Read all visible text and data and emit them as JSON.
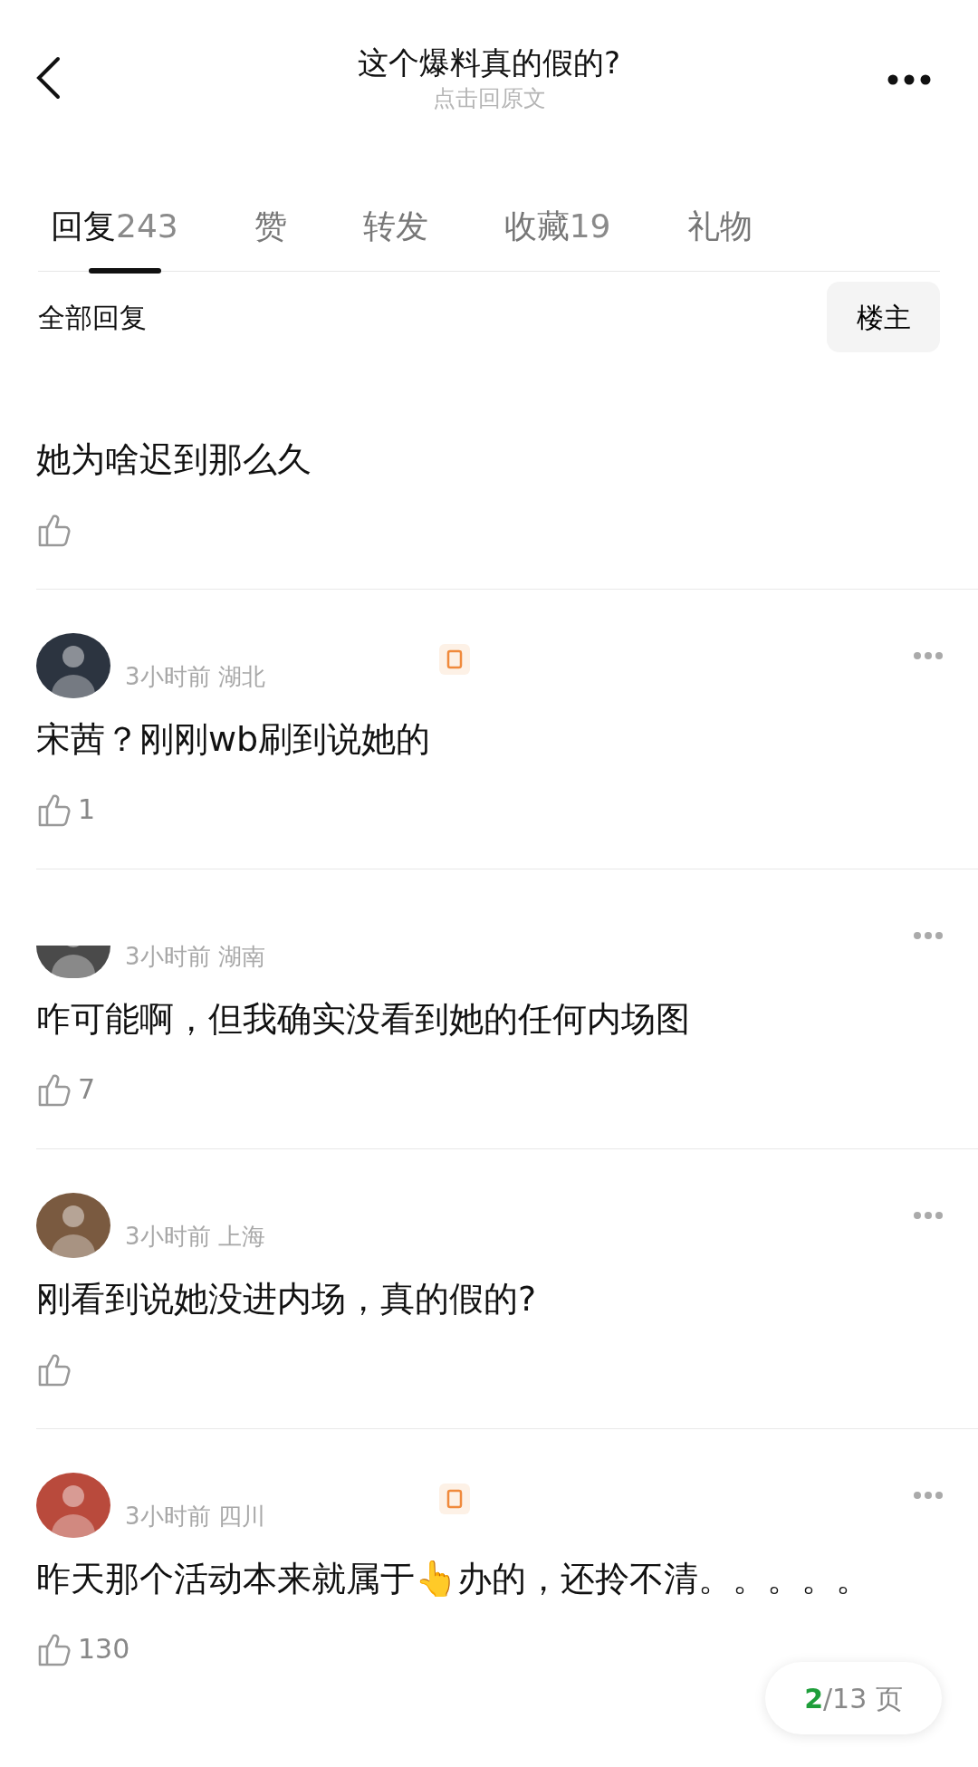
{
  "header": {
    "title": "这个爆料真的假的?",
    "subtitle": "点击回原文"
  },
  "tabs": [
    {
      "label": "回复",
      "count": "243",
      "selected": true
    },
    {
      "label": "赞",
      "selected": false
    },
    {
      "label": "转发",
      "selected": false
    },
    {
      "label": "收藏",
      "count": "19",
      "selected": false
    },
    {
      "label": "礼物",
      "selected": false
    }
  ],
  "filter": {
    "label": "全部回复",
    "button": "楼主"
  },
  "comments": [
    {
      "kind": "cut",
      "text": "她为啥迟到那么久"
    },
    {
      "kind": "full",
      "badge": true,
      "time": "3小时前",
      "location": "湖北",
      "text": "宋茜？刚刚wb刷到说她的",
      "likes": "1"
    },
    {
      "kind": "full",
      "badge": false,
      "avatar_cut": true,
      "time": "3小时前",
      "location": "湖南",
      "text": "咋可能啊，但我确实没看到她的任何内场图",
      "likes": "7"
    },
    {
      "kind": "full",
      "badge": false,
      "time": "3小时前",
      "location": "上海",
      "text": "刚看到说她没进内场，真的假的?"
    },
    {
      "kind": "full",
      "badge": true,
      "time": "3小时前",
      "location": "四川",
      "text": "昨天那个活动本来就属于👆办的，还拎不清。。。。。",
      "likes": "130"
    }
  ],
  "pager": {
    "current": "2",
    "total": "/13 页"
  }
}
